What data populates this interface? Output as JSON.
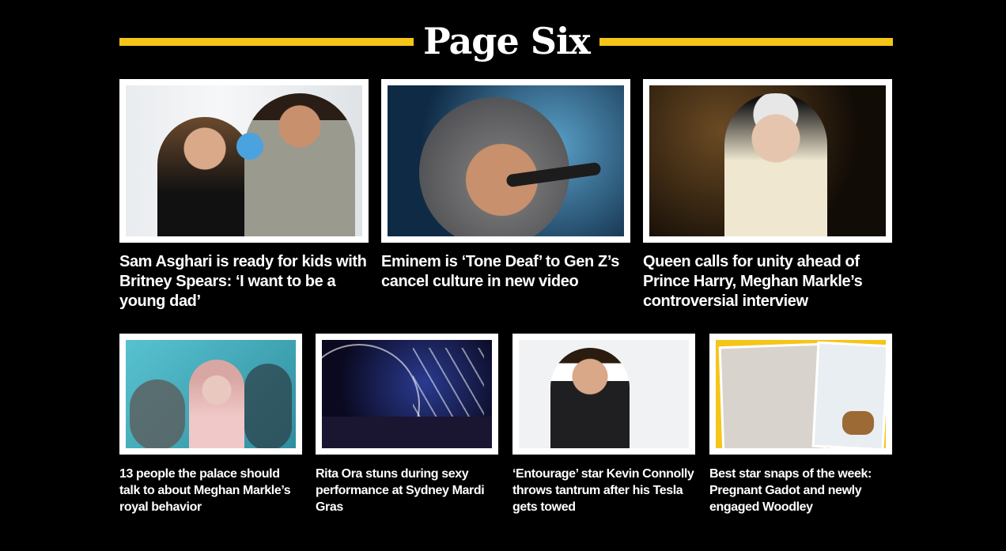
{
  "header": {
    "logo_text": "Page Six",
    "accent_color": "#f5c518"
  },
  "featured": [
    {
      "headline": "Sam Asghari is ready for kids with Britney Spears: ‘I want to be a young dad’",
      "image": "britney-spears-sam-asghari-photo"
    },
    {
      "headline": "Eminem is ‘Tone Deaf’ to Gen Z’s cancel culture in new video",
      "image": "eminem-performing-photo"
    },
    {
      "headline": "Queen calls for unity ahead of Prince Harry, Meghan Markle’s controversial interview",
      "image": "queen-elizabeth-photo"
    }
  ],
  "secondary": [
    {
      "headline": "13 people the palace should talk to about Meghan Markle’s royal behavior",
      "image": "meghan-markle-collage-photo"
    },
    {
      "headline": "Rita Ora stuns during sexy performance at Sydney Mardi Gras",
      "image": "rita-ora-performance-photo"
    },
    {
      "headline": "‘Entourage’ star Kevin Connolly throws tantrum after his Tesla gets towed",
      "image": "kevin-connolly-photo"
    },
    {
      "headline": "Best star snaps of the week: Pregnant Gadot and newly engaged Woodley",
      "image": "star-snaps-collage-photo"
    }
  ]
}
